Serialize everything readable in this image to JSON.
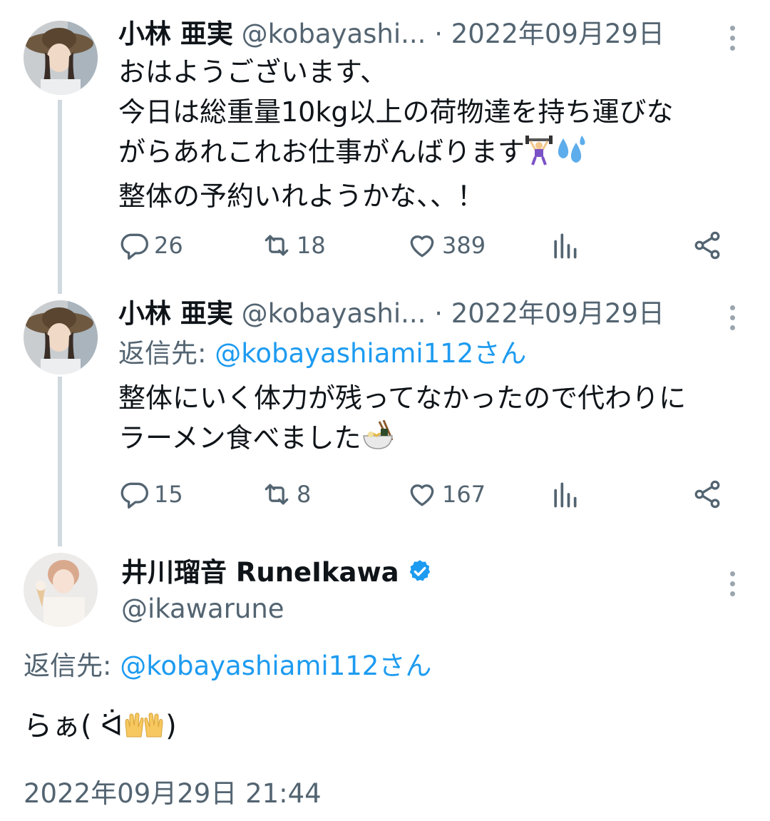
{
  "tweets": [
    {
      "name": "小林 亜実",
      "handle": "@kobayashi...",
      "date": "· 2022年09月29日",
      "lines": [
        "おはようございます、",
        "今日は総重量10kg以上の荷物達を持ち運びな",
        "がらあれこれお仕事がんばります",
        "整体の予約いれようかな、、！"
      ],
      "emojis": [
        "weightlifter",
        "sweat-droplets"
      ],
      "replies": "26",
      "retweets": "18",
      "likes": "389"
    },
    {
      "name": "小林 亜実",
      "handle": "@kobayashi...",
      "date": "· 2022年09月29日",
      "reply_label": "返信先: ",
      "reply_to": "@kobayashiami112さん",
      "lines": [
        "整体にいく体力が残ってなかったので代わりに",
        "ラーメン食べました"
      ],
      "emojis": [
        "ramen-bowl"
      ],
      "replies": "15",
      "retweets": "8",
      "likes": "167"
    }
  ],
  "main_tweet": {
    "name": "井川瑠音 RuneIkawa",
    "handle": "@ikawarune",
    "verified": true,
    "reply_label": "返信先: ",
    "reply_to": "@kobayashiami112さん",
    "text": "らぁ( ᐛ",
    "text_end": ")",
    "emojis": [
      "raising-hands"
    ],
    "timestamp": "2022年09月29日 21:44"
  },
  "colors": {
    "accent": "#1d9bf0",
    "verified": "#1d9bf0",
    "muted": "#536471",
    "thread_line": "#cfd9de"
  }
}
